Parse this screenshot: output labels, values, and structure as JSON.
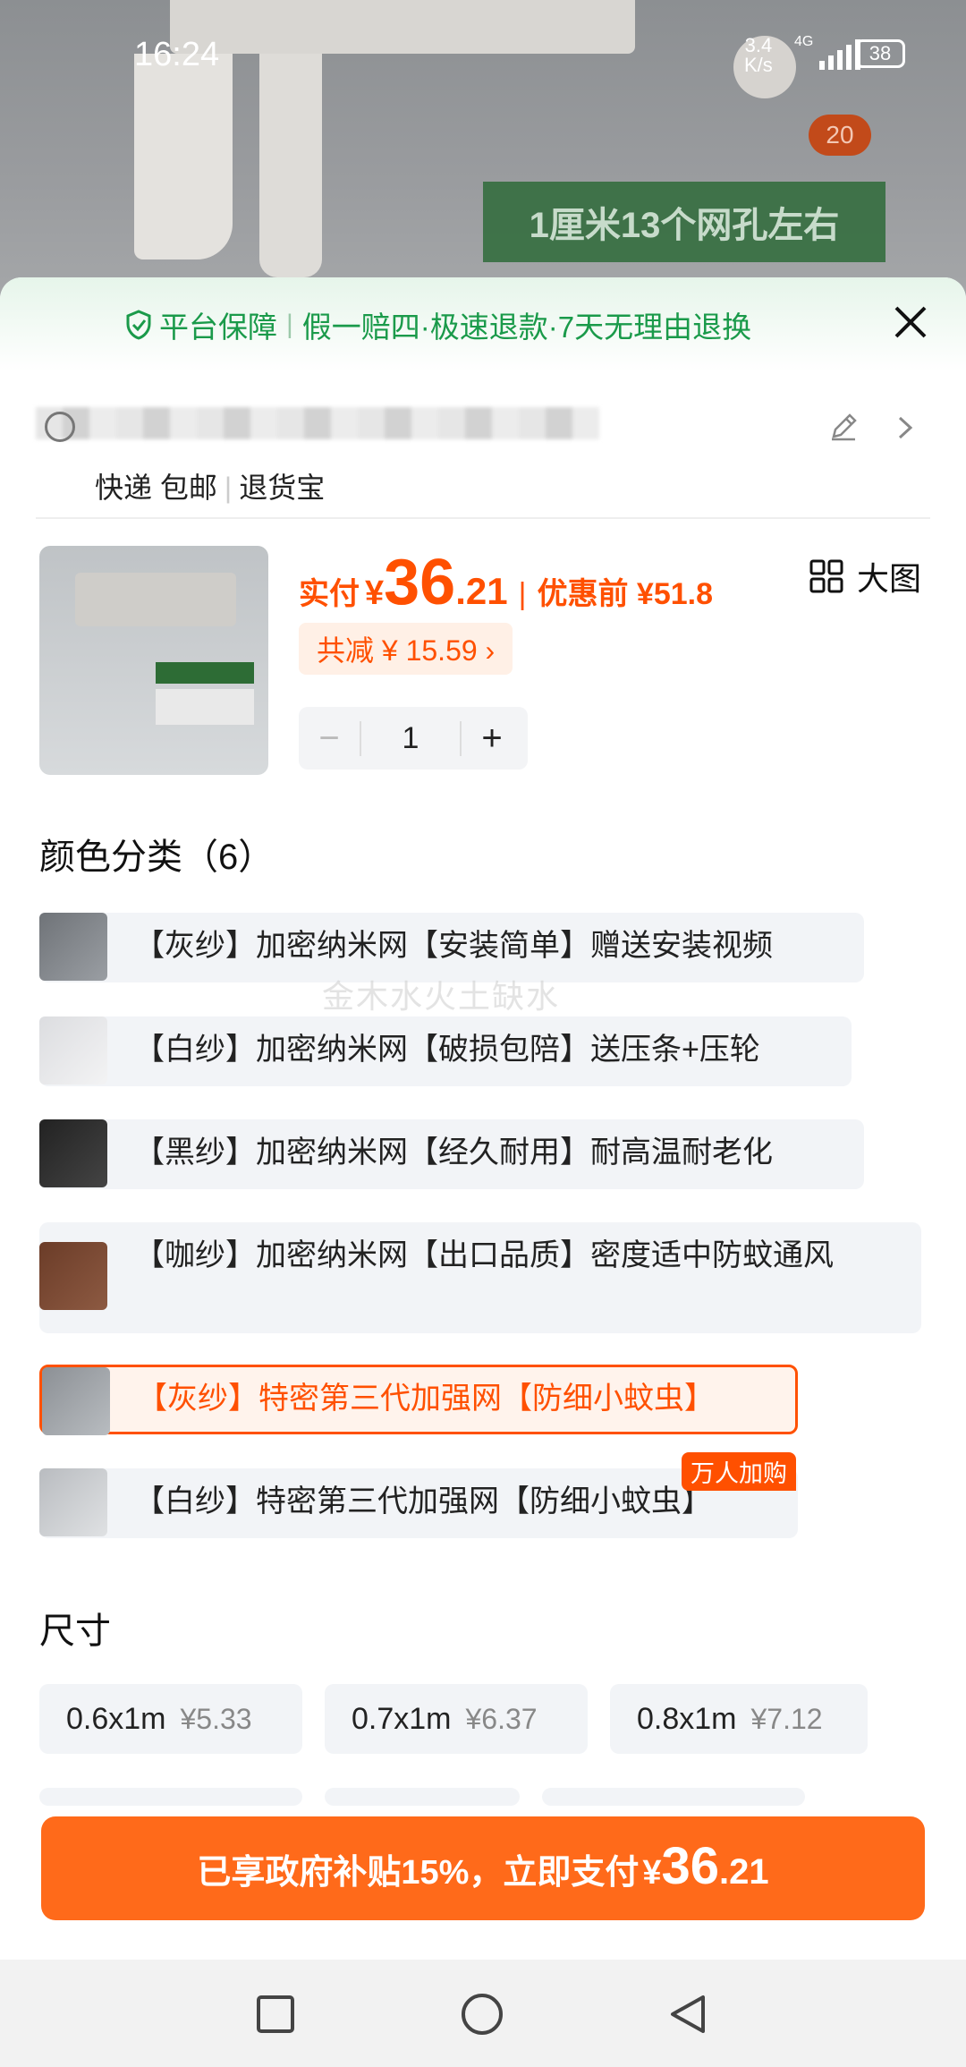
{
  "status_bar": {
    "time": "16:24",
    "net_speed": "3.4",
    "net_unit": "K/s",
    "network": "4G",
    "battery": "38"
  },
  "photo": {
    "overlay_text": "1厘米13个网孔左右",
    "image_count": "20"
  },
  "assurance": {
    "title": "平台保障",
    "items": "假一赔四·极速退款·7天无理由退换"
  },
  "address": {
    "tags": [
      "快递 包邮",
      "退货宝"
    ]
  },
  "product": {
    "price_label": "实付",
    "currency": "¥",
    "price_int": "36",
    "price_dec": ".21",
    "pre_label": "优惠前 ¥51.8",
    "discount": "共减 ¥ 15.59 ›",
    "quantity": "1",
    "minus": "−",
    "plus": "+"
  },
  "color_section": {
    "title": "颜色分类（6）",
    "big_view": "大图",
    "options": [
      {
        "label": "【灰纱】加密纳米网【安装简单】赠送安装视频"
      },
      {
        "label": "【白纱】加密纳米网【破损包陪】送压条+压轮"
      },
      {
        "label": "【黑纱】加密纳米网【经久耐用】耐高温耐老化"
      },
      {
        "label": "【咖纱】加密纳米网【出口品质】密度适中防蚊通风"
      },
      {
        "label": "【灰纱】特密第三代加强网【防细小蚊虫】",
        "selected": true
      },
      {
        "label": "【白纱】特密第三代加强网【防细小蚊虫】",
        "tag": "万人加购"
      }
    ],
    "watermark": "金木水火土缺水"
  },
  "size_section": {
    "title": "尺寸",
    "sizes": [
      {
        "size": "0.6x1m",
        "price": "¥5.33"
      },
      {
        "size": "0.7x1m",
        "price": "¥6.37"
      },
      {
        "size": "0.8x1m",
        "price": "¥7.12"
      }
    ]
  },
  "pay_button": {
    "text": "已享政府补贴15%，立即支付",
    "currency": "¥",
    "price_int": "36",
    "price_dec": ".21"
  },
  "colors": {
    "accent": "#ff5000",
    "assurance_green": "#1a9a4a",
    "pay_button": "#ff6a1a"
  }
}
